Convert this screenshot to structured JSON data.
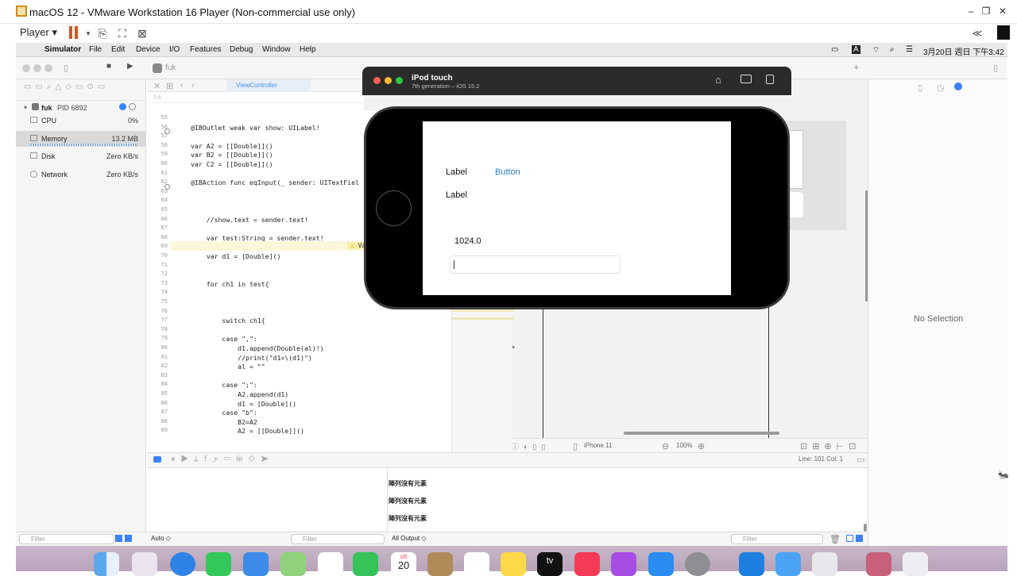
{
  "vm": {
    "title": "macOS 12 - VMware Workstation 16 Player (Non-commercial use only)",
    "player_label": "Player",
    "win_min": "–",
    "win_max": "❐",
    "win_close": "✕",
    "collapse": "≪"
  },
  "menubar": {
    "app": "Simulator",
    "items": [
      "File",
      "Edit",
      "Device",
      "I/O",
      "Features",
      "Debug",
      "Window",
      "Help"
    ],
    "clock": "3月20日 週日 下午3:42"
  },
  "xcode": {
    "scheme": "fuk",
    "tab": "ViewController",
    "breadcrumb": "fuk",
    "process": {
      "name": "fuk",
      "pid": "PID 6892"
    },
    "gauges": [
      {
        "label": "CPU",
        "value": "0%"
      },
      {
        "label": "Memory",
        "value": "13.2 MB"
      },
      {
        "label": "Disk",
        "value": "Zero KB/s"
      },
      {
        "label": "Network",
        "value": "Zero KB/s"
      }
    ],
    "code": [
      {
        "n": "55",
        "t": ""
      },
      {
        "n": "56",
        "t": "@IBOutlet weak var show: UILabel!"
      },
      {
        "n": "57",
        "t": ""
      },
      {
        "n": "58",
        "t": "var A2 = [[Double]]()"
      },
      {
        "n": "59",
        "t": "var B2 = [[Double]]()"
      },
      {
        "n": "60",
        "t": "var C2 = [[Double]]()"
      },
      {
        "n": "61",
        "t": ""
      },
      {
        "n": "62",
        "t": "@IBAction func eqInput(_ sender: UITextFiel"
      },
      {
        "n": "63",
        "t": ""
      },
      {
        "n": "64",
        "t": ""
      },
      {
        "n": "65",
        "t": ""
      },
      {
        "n": "66",
        "t": "    //show.text = sender.text!"
      },
      {
        "n": "67",
        "t": ""
      },
      {
        "n": "68",
        "t": "    var test:String = sender.text!"
      },
      {
        "n": "69",
        "t": "    var al:String = \"\""
      },
      {
        "n": "70",
        "t": "    var d1 = [Double]()"
      },
      {
        "n": "71",
        "t": ""
      },
      {
        "n": "72",
        "t": ""
      },
      {
        "n": "73",
        "t": "    for ch1 in test{"
      },
      {
        "n": "74",
        "t": ""
      },
      {
        "n": "75",
        "t": ""
      },
      {
        "n": "76",
        "t": ""
      },
      {
        "n": "77",
        "t": "        switch ch1{"
      },
      {
        "n": "78",
        "t": ""
      },
      {
        "n": "79",
        "t": "        case \",\":"
      },
      {
        "n": "80",
        "t": "            d1.append(Double(al)!)"
      },
      {
        "n": "81",
        "t": "            //print(\"d1=\\(d1)\")"
      },
      {
        "n": "82",
        "t": "            al = \"\""
      },
      {
        "n": "83",
        "t": ""
      },
      {
        "n": "84",
        "t": "        case \";\":"
      },
      {
        "n": "85",
        "t": "            A2.append(d1)"
      },
      {
        "n": "86",
        "t": "            d1 = [Double]()"
      },
      {
        "n": "87",
        "t": "        case \"b\":"
      },
      {
        "n": "88",
        "t": "            B2=A2"
      },
      {
        "n": "89",
        "t": "            A2 = [[Double]]()"
      }
    ],
    "warning_label": "Varia",
    "device": "iPhone 11",
    "zoom": "100%",
    "status": "Line: 101  Col: 1",
    "no_selection": "No Selection",
    "console_lines": [
      "陣列沒有元素",
      "陣列沒有元素",
      "陣列沒有元素"
    ],
    "filter_placeholder": "Filter",
    "auto_label": "Auto ◇",
    "all_output_label": "All Output ◇"
  },
  "simulator": {
    "device_name": "iPod touch",
    "device_sub": "7th generation – iOS 15.2",
    "label1": "Label",
    "button": "Button",
    "label2": "Label",
    "result": "1024.0"
  },
  "dock": {
    "calendar_month": "3月",
    "calendar_day": "20",
    "tv": "tv"
  }
}
